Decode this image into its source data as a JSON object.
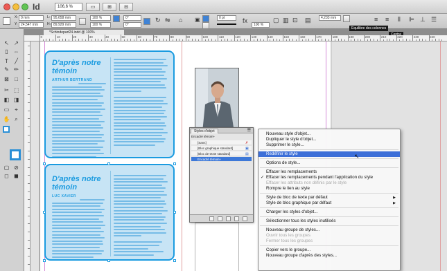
{
  "app": {
    "logo": "Id",
    "zoom": "106,6 %"
  },
  "control": {
    "x": "0 mm",
    "y": "24,547 mm",
    "w": "95,658 mm",
    "h": "89,929 mm",
    "angle": "0°",
    "shear": "0°",
    "stroke_weight": "0 pt",
    "opacity": "100 %",
    "gutter": "4,233 mm",
    "tooltip_columns": "Equilibre des colonnes",
    "tooltip_center": "Centre"
  },
  "document": {
    "tab_title": "*Schindepart24.indd @ 100%",
    "ruler_labels": [
      "0",
      "10",
      "20",
      "30",
      "40",
      "50",
      "60",
      "70",
      "80",
      "90",
      "100",
      "110",
      "120",
      "130",
      "140",
      "150",
      "160",
      "170",
      "180",
      "190",
      "200",
      "210",
      "220",
      "230",
      "240",
      "250"
    ]
  },
  "frames": [
    {
      "title_l1": "D'après notre",
      "title_l2": "témoin",
      "author": "ARTHUR BERTRAND"
    },
    {
      "title_l1": "D'après notre",
      "title_l2": "témoin",
      "author": "LUC XAVIER"
    }
  ],
  "styles_panel": {
    "tab": "Styles d'objet",
    "current": "Encadré témoin+",
    "rows": [
      {
        "label": "[Sans]",
        "selected": false
      },
      {
        "label": "[Bloc graphique standard]",
        "selected": false
      },
      {
        "label": "[Bloc de texte standard]",
        "selected": false
      },
      {
        "label": "Encadré témoin+",
        "selected": true
      }
    ]
  },
  "menu": {
    "items": [
      {
        "label": "Nouveau style d'objet...",
        "state": "normal"
      },
      {
        "label": "Dupliquer le style d'objet...",
        "state": "normal"
      },
      {
        "label": "Supprimer le style...",
        "state": "normal"
      },
      {
        "label": "Redéfinir le style",
        "state": "highlighted"
      },
      {
        "label": "Options de style...",
        "state": "normal"
      },
      {
        "label": "Effacer les remplacements",
        "state": "normal"
      },
      {
        "label": "Effacer les remplacements pendant l'application du style",
        "state": "checked"
      },
      {
        "label": "Effacer les attributs non définis par le style",
        "state": "disabled"
      },
      {
        "label": "Rompre le lien au style",
        "state": "normal"
      },
      {
        "label": "Style de bloc de texte par défaut",
        "state": "submenu"
      },
      {
        "label": "Style de bloc graphique par défaut",
        "state": "submenu"
      },
      {
        "label": "Charger les styles d'objet...",
        "state": "normal"
      },
      {
        "label": "Sélectionner tous les styles inutilisés",
        "state": "normal"
      },
      {
        "label": "Nouveau groupe de styles...",
        "state": "normal"
      },
      {
        "label": "Ouvrir tous les groupes",
        "state": "disabled"
      },
      {
        "label": "Fermer tous les groupes",
        "state": "disabled"
      },
      {
        "label": "Copier vers le groupe...",
        "state": "normal"
      },
      {
        "label": "Nouveau groupe d'après des styles...",
        "state": "normal"
      }
    ]
  },
  "colors": {
    "accent": "#1a9be0",
    "frame_fill": "#c7e4f5",
    "menu_highlight": "#3d6fd8"
  }
}
